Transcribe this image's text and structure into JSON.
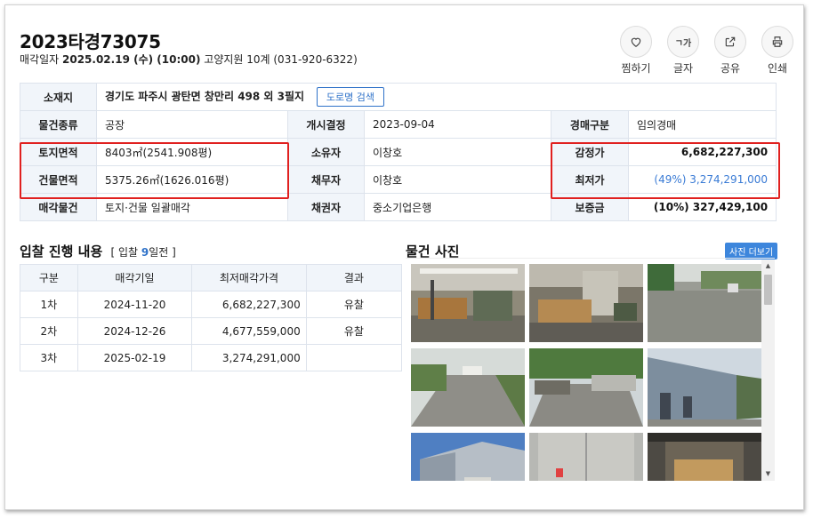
{
  "header": {
    "case_number": "2023타경73075",
    "sale_date_label": "매각일자",
    "sale_date": "2025.02.19 (수) (10:00)",
    "court": "고양지원 10계 (031-920-6322)"
  },
  "actions": [
    {
      "label": "찜하기",
      "icon": "heart-icon"
    },
    {
      "label": "글자",
      "icon": "font-size-icon",
      "glyph": "ㄱ가"
    },
    {
      "label": "공유",
      "icon": "share-icon"
    },
    {
      "label": "인쇄",
      "icon": "print-icon"
    }
  ],
  "info": {
    "location_label": "소재지",
    "location": "경기도 파주시 광탄면 창만리 498 외 3필지",
    "road_search_label": "도로명 검색",
    "property_type_label": "물건종류",
    "property_type": "공장",
    "commence_label": "개시결정",
    "commence": "2023-09-04",
    "auction_type_label": "경매구분",
    "auction_type": "임의경매",
    "land_area_label": "토지면적",
    "land_area": "8403㎡(2541.908평)",
    "owner_label": "소유자",
    "owner": "이창호",
    "appraisal_label": "감정가",
    "appraisal": "6,682,227,300",
    "building_area_label": "건물면적",
    "building_area": "5375.26㎡(1626.016평)",
    "debtor_label": "채무자",
    "debtor": "이창호",
    "minimum_label": "최저가",
    "minimum": "(49%) 3,274,291,000",
    "sale_item_label": "매각물건",
    "sale_item": "토지·건물 일괄매각",
    "creditor_label": "채권자",
    "creditor": "중소기업은행",
    "deposit_label": "보증금",
    "deposit": "(10%) 327,429,100"
  },
  "bid": {
    "title": "입찰 진행 내용",
    "sub_prefix": "[ 입찰 ",
    "sub_days": "9",
    "sub_suffix": "일전 ]",
    "columns": [
      "구분",
      "매각기일",
      "최저매각가격",
      "결과"
    ],
    "rows": [
      [
        "1차",
        "2024-11-20",
        "6,682,227,300",
        "유찰"
      ],
      [
        "2차",
        "2024-12-26",
        "4,677,559,000",
        "유찰"
      ],
      [
        "3차",
        "2025-02-19",
        "3,274,291,000",
        ""
      ]
    ]
  },
  "photos": {
    "title": "물건 사진",
    "more_label": "사진 더보기"
  },
  "colors": {
    "accent": "#2f72c9",
    "highlight": "#e0201f",
    "header_bg": "#f1f5fa",
    "minimum_price": "#3a7bd5"
  }
}
